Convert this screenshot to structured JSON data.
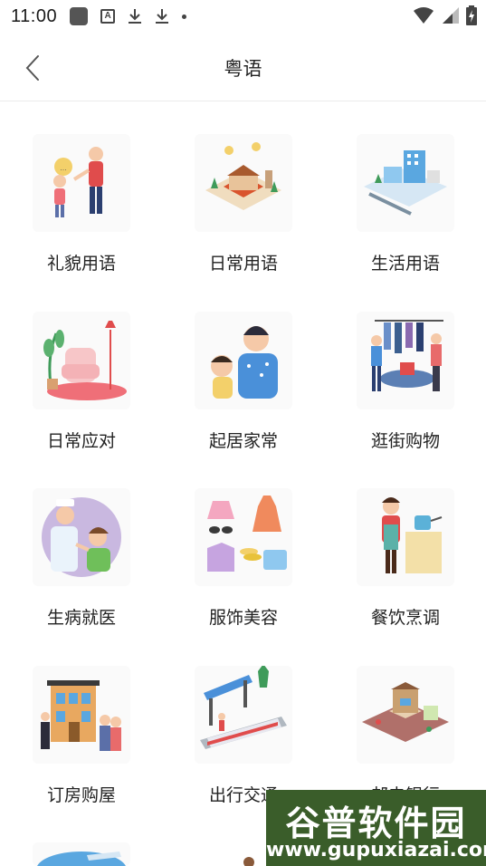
{
  "status_bar": {
    "time": "11:00",
    "icons": [
      "app-icon",
      "a-icon",
      "download-icon",
      "download-icon",
      "dot-icon",
      "wifi-icon",
      "signal-icon",
      "battery-icon"
    ]
  },
  "header": {
    "title": "粤语",
    "back_icon": "chevron-left-icon"
  },
  "categories": [
    {
      "label": "礼貌用语",
      "icon": "polite-phrases-illustration"
    },
    {
      "label": "日常用语",
      "icon": "daily-phrases-illustration"
    },
    {
      "label": "生活用语",
      "icon": "life-phrases-illustration"
    },
    {
      "label": "日常应对",
      "icon": "daily-response-illustration"
    },
    {
      "label": "起居家常",
      "icon": "home-life-illustration"
    },
    {
      "label": "逛街购物",
      "icon": "shopping-illustration"
    },
    {
      "label": "生病就医",
      "icon": "medical-illustration"
    },
    {
      "label": "服饰美容",
      "icon": "fashion-illustration"
    },
    {
      "label": "餐饮烹调",
      "icon": "cooking-illustration"
    },
    {
      "label": "订房购屋",
      "icon": "housing-illustration"
    },
    {
      "label": "出行交通",
      "icon": "transport-illustration"
    },
    {
      "label": "邮电银行",
      "icon": "post-bank-illustration"
    }
  ],
  "watermark": {
    "title": "谷普软件园",
    "url": "www.gupuxiazai.com"
  },
  "colors": {
    "background": "#ffffff",
    "text": "#222222",
    "divider": "#ececec",
    "watermark_bg": "#3a5d2a"
  }
}
